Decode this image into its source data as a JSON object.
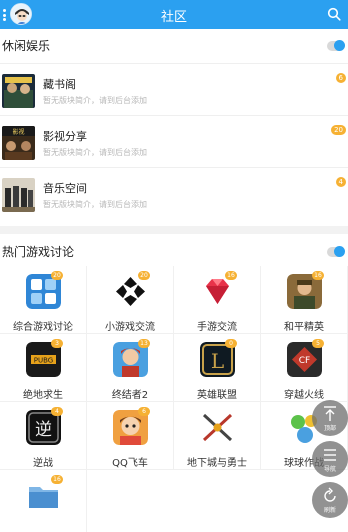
{
  "header": {
    "title": "社区"
  },
  "leisure": {
    "title": "休闲娱乐",
    "forums": [
      {
        "name": "藏书阁",
        "desc": "暂无版块简介，请到后台添加",
        "badge": "6"
      },
      {
        "name": "影视分享",
        "desc": "暂无版块简介，请到后台添加",
        "badge": "20"
      },
      {
        "name": "音乐空间",
        "desc": "暂无版块简介，请到后台添加",
        "badge": "4"
      }
    ]
  },
  "hot_games": {
    "title": "热门游戏讨论",
    "items": [
      {
        "label": "综合游戏讨论",
        "badge": "20"
      },
      {
        "label": "小游戏交流",
        "badge": "20"
      },
      {
        "label": "手游交流",
        "badge": "16"
      },
      {
        "label": "和平精英",
        "badge": "16"
      },
      {
        "label": "绝地求生",
        "badge": "3"
      },
      {
        "label": "终结者2",
        "badge": "13"
      },
      {
        "label": "英雄联盟",
        "badge": "0"
      },
      {
        "label": "穿越火线",
        "badge": "5"
      },
      {
        "label": "逆战",
        "badge": "4"
      },
      {
        "label": "QQ飞车",
        "badge": "6"
      },
      {
        "label": "地下城与勇士",
        "badge": ""
      },
      {
        "label": "球球作战",
        "badge": ""
      },
      {
        "label": "",
        "badge": "16"
      }
    ]
  },
  "fab": {
    "top_label": "顶部",
    "nav_label": "导航",
    "refresh_label": "刷新"
  },
  "colors": {
    "accent": "#2ba0f0",
    "badge": "#f6b133"
  }
}
